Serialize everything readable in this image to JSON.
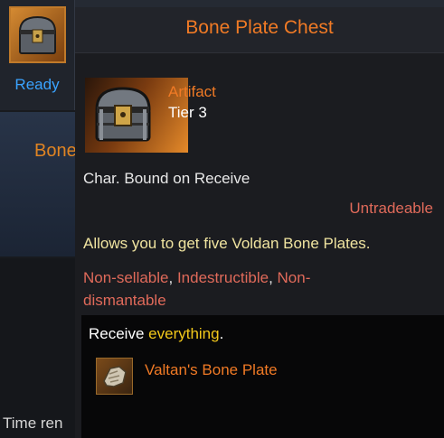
{
  "background": {
    "slot_status": "Ready",
    "panel_title_partial": "Bone",
    "footer_text_partial": "Time ren"
  },
  "tooltip": {
    "title": "Bone Plate Chest",
    "icon": "treasure-chest-icon",
    "grade": "Artifact",
    "tier": "Tier 3",
    "binding": "Char. Bound on Receive",
    "trade_status": "Untradeable",
    "description": "Allows you to get five Voldan Bone Plates.",
    "flags": {
      "non_sellable": "Non-sellable",
      "indestructible": "Indestructible",
      "non_dismantable": "Non-dismantable"
    },
    "reward": {
      "prefix": "Receive",
      "highlight": "everything",
      "suffix": ".",
      "item_name": "Valtan's Bone Plate",
      "item_icon": "bone-plate-icon"
    }
  },
  "colors": {
    "title_orange": "#f07a25",
    "ready_blue": "#3aa3ff",
    "warning_red": "#e06a5a",
    "description_yellow": "#f0e4a0",
    "highlight_yellow": "#f2c81a"
  }
}
